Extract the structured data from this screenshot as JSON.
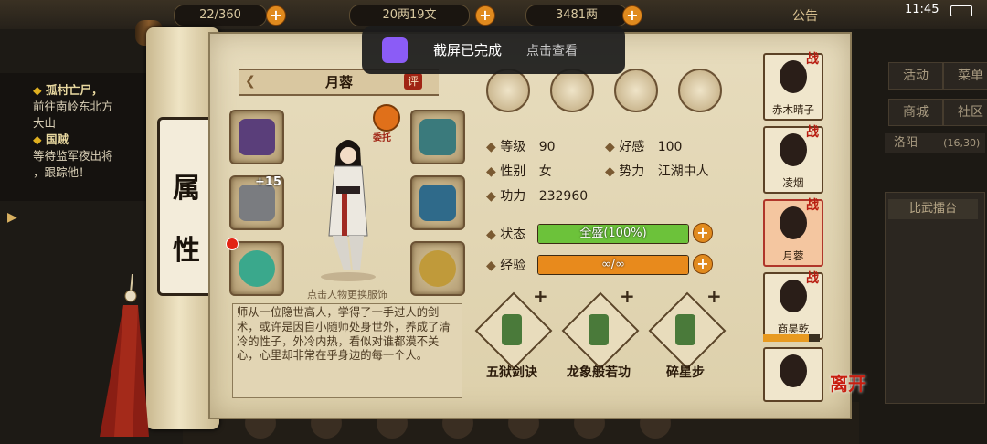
{
  "hud": {
    "top_left": "22/360",
    "currency1": "20两19文",
    "currency2": "3481两",
    "announcement": "公告",
    "time": "11:45"
  },
  "toast": {
    "title": "截屏已完成",
    "action": "点击查看"
  },
  "quest": {
    "q1_title": "孤村亡尸，",
    "q1_line1": "前往南岭东北方",
    "q1_line2": "大山",
    "q2_title": "国贼",
    "q2_line1": "等待监军夜出将",
    "q2_line2": "，跟踪他！"
  },
  "side_tab": {
    "line1": "属",
    "line2": "性"
  },
  "character": {
    "name": "月蓉",
    "rate_badge": "评",
    "entrust": "委托",
    "plus_level": "+15",
    "figure_hint": "点击人物更换服饰",
    "description": "师从一位隐世高人，学得了一手过人的剑术，或许是因自小随师处身世外，养成了清冷的性子，外冷内热，看似对谁都漠不关心，心里却非常在乎身边的每一个人。"
  },
  "stats": {
    "level_label": "等级",
    "level": "90",
    "favor_label": "好感",
    "favor": "100",
    "gender_label": "性别",
    "gender": "女",
    "faction_label": "势力",
    "faction": "江湖中人",
    "power_label": "功力",
    "power": "232960",
    "status_label": "状态",
    "status_text": "全盛(100%)",
    "status_fill": 1.0,
    "exp_label": "经验",
    "exp_text": "∞/∞",
    "exp_fill": 1.0
  },
  "skills": [
    {
      "name": "五狱剑诀"
    },
    {
      "name": "龙象般若功"
    },
    {
      "name": "碎星步"
    }
  ],
  "roster": [
    {
      "name": "赤木晴子",
      "tag": "战"
    },
    {
      "name": "凌烟",
      "tag": "战"
    },
    {
      "name": "月蓉",
      "tag": "战"
    },
    {
      "name": "商昊乾",
      "tag": "战"
    },
    {
      "name": "",
      "tag": ""
    }
  ],
  "right_menu": {
    "activity": "活动",
    "menu": "菜单",
    "shop": "商城",
    "community": "社区",
    "location": "洛阳",
    "coords": "(16,30)",
    "arena": "比武擂台"
  },
  "leave": "离开",
  "colors": {
    "status_bar": "#6cc23a",
    "exp_bar": "#e88a1c",
    "accent_red": "#b81c10"
  }
}
